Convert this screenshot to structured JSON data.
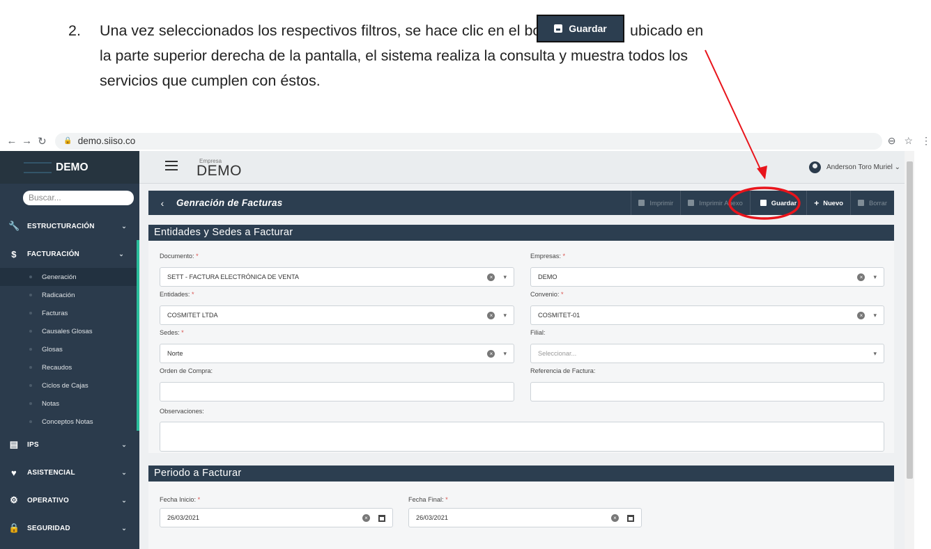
{
  "instruction": {
    "number": "2.",
    "line1_before": "Una vez seleccionados los respectivos filtros, se hace clic en el botón",
    "line1_after": "ubicado en",
    "line2": "la parte superior derecha de la pantalla, el sistema realiza la consulta y muestra todos los",
    "line3": "servicios que cumplen con éstos.",
    "button_label": "Guardar"
  },
  "browser": {
    "url": "demo.siiso.co"
  },
  "sidebar": {
    "logo": "DEMO",
    "search_placeholder": "Buscar...",
    "sections": [
      {
        "label": "ESTRUCTURACIÓN"
      },
      {
        "label": "FACTURACIÓN"
      },
      {
        "label": "IPS"
      },
      {
        "label": "ASISTENCIAL"
      },
      {
        "label": "OPERATIVO"
      },
      {
        "label": "SEGURIDAD"
      }
    ],
    "facturacion_items": [
      "Generación",
      "Radicación",
      "Facturas",
      "Causales Glosas",
      "Glosas",
      "Recaudos",
      "Ciclos de Cajas",
      "Notas",
      "Conceptos Notas"
    ]
  },
  "header": {
    "empresa_label": "Empresa",
    "empresa_name": "DEMO",
    "user": "Anderson Toro Muriel ⌄"
  },
  "toolbar": {
    "title": "Genración de Facturas",
    "imprimir": "Imprimir",
    "imprimir_anexo": "Imprimir Anexo",
    "guardar": "Guardar",
    "nuevo": "Nuevo",
    "borrar": "Borrar"
  },
  "entidades": {
    "heading": "Entidades y Sedes a Facturar",
    "documento_label": "Documento:",
    "documento_value": "SETT - FACTURA ELECTRÓNICA DE VENTA",
    "empresas_label": "Empresas:",
    "empresas_value": "DEMO",
    "entidades_label": "Entidades:",
    "entidades_value": "COSMITET LTDA",
    "convenio_label": "Convenio:",
    "convenio_value": "COSMITET-01",
    "sedes_label": "Sedes:",
    "sedes_value": "Norte",
    "filial_label": "Filial:",
    "filial_placeholder": "Seleccionar...",
    "orden_label": "Orden de Compra:",
    "referencia_label": "Referencia de Factura:",
    "observaciones_label": "Observaciones:"
  },
  "periodo": {
    "heading": "Periodo a Facturar",
    "inicio_label": "Fecha Inicio:",
    "inicio_value": "26/03/2021",
    "final_label": "Fecha Final:",
    "final_value": "26/03/2021"
  },
  "colors": {
    "sidebar_bg": "#2b3b4c",
    "panel_header": "#2c3e50",
    "accent_green": "#2bbd9b",
    "annotation_red": "#e8141b"
  }
}
